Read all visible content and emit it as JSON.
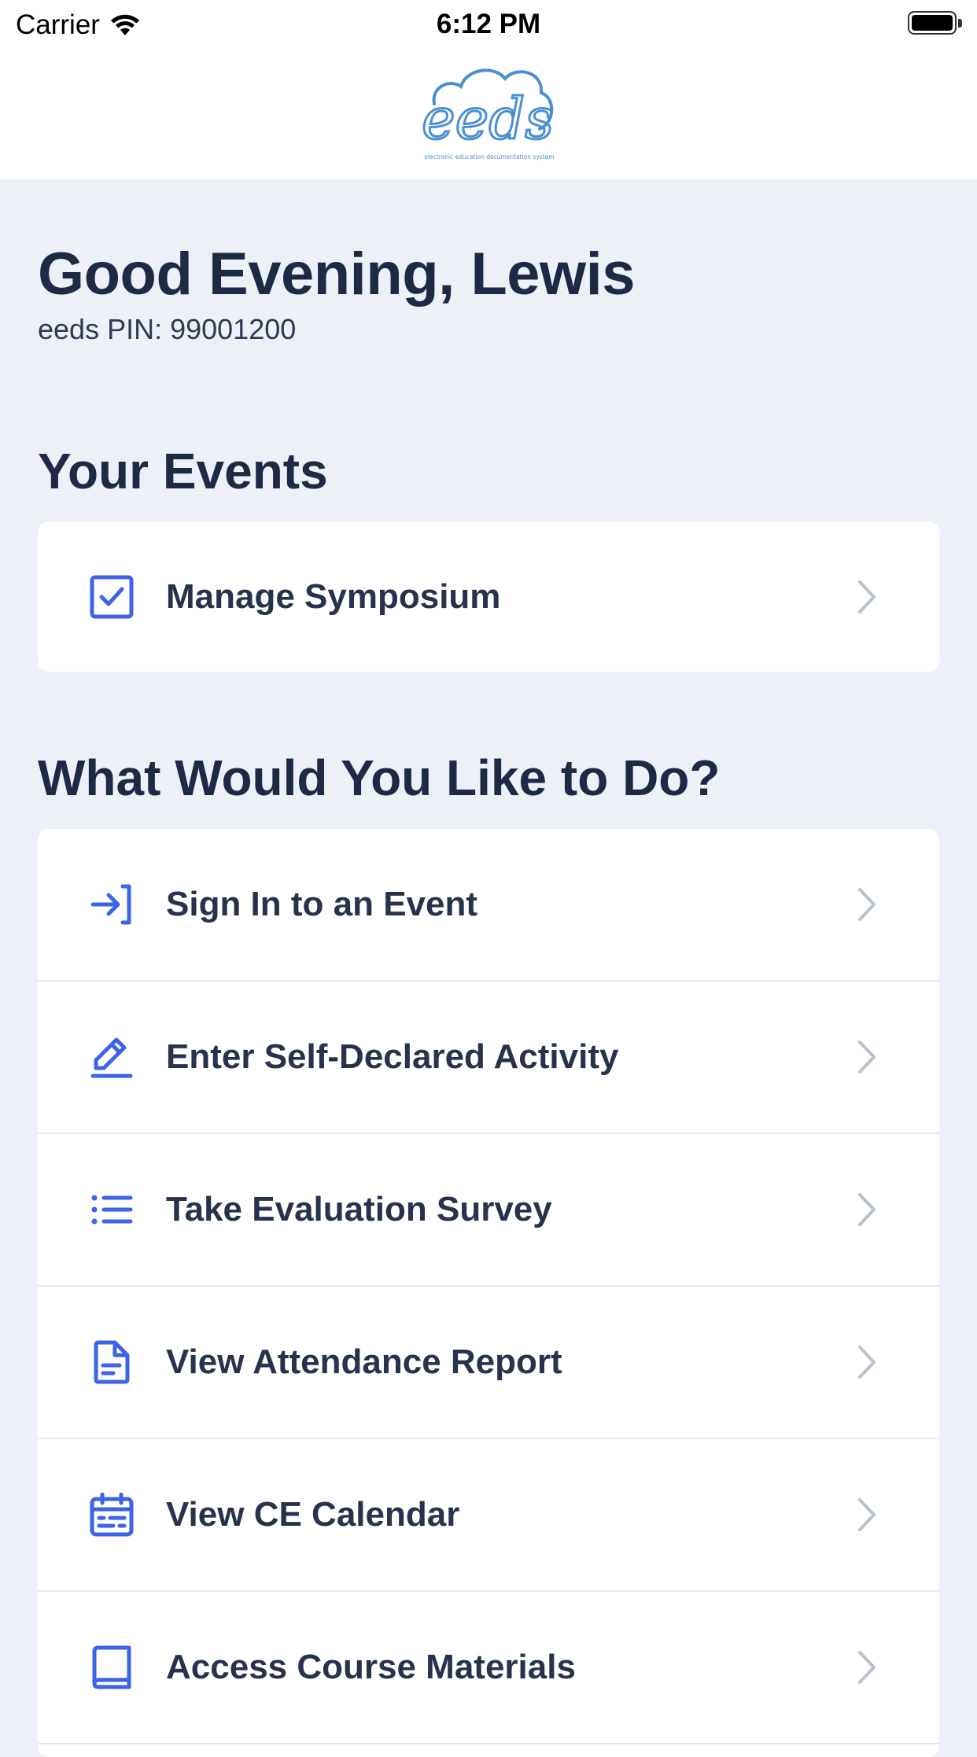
{
  "status_bar": {
    "carrier": "Carrier",
    "time": "6:12 PM"
  },
  "header": {
    "logo_text": "eeds",
    "logo_tagline": "electronic education documentation system"
  },
  "greeting": {
    "title": "Good Evening, Lewis",
    "pin": "eeds PIN: 99001200"
  },
  "your_events": {
    "title": "Your Events",
    "items": [
      {
        "label": "Manage Symposium",
        "icon": "checkbox-icon"
      }
    ]
  },
  "actions": {
    "title": "What Would You Like to Do?",
    "items": [
      {
        "label": "Sign In to an Event",
        "icon": "sign-in-icon"
      },
      {
        "label": "Enter Self-Declared Activity",
        "icon": "pencil-icon"
      },
      {
        "label": "Take Evaluation Survey",
        "icon": "list-icon"
      },
      {
        "label": "View Attendance Report",
        "icon": "document-icon"
      },
      {
        "label": "View CE Calendar",
        "icon": "calendar-icon"
      },
      {
        "label": "Access Course Materials",
        "icon": "book-icon"
      }
    ]
  },
  "colors": {
    "accent": "#3d63e8",
    "background": "#edf0f7",
    "text": "#1e2a45",
    "logo": "#4a8fd0",
    "chevron": "#b9c0cf"
  }
}
